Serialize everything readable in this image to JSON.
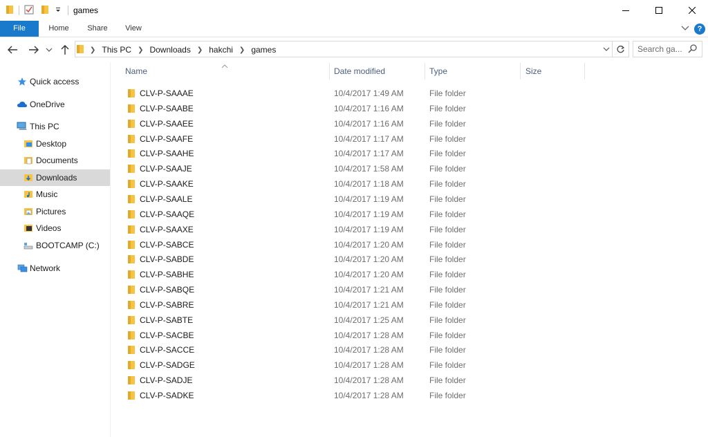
{
  "window": {
    "title": "games"
  },
  "ribbon": {
    "tabs": [
      "File",
      "Home",
      "Share",
      "View"
    ]
  },
  "address": {
    "crumbs": [
      "This PC",
      "Downloads",
      "hakchi",
      "games"
    ],
    "search_placeholder": "Search ga..."
  },
  "sidebar": {
    "items": [
      {
        "label": "Quick access",
        "icon": "star-icon"
      },
      {
        "label": "OneDrive",
        "icon": "onedrive-icon"
      },
      {
        "label": "This PC",
        "icon": "computer-icon"
      },
      {
        "label": "Desktop",
        "icon": "desktop-folder-icon"
      },
      {
        "label": "Documents",
        "icon": "documents-folder-icon"
      },
      {
        "label": "Downloads",
        "icon": "downloads-folder-icon",
        "selected": true
      },
      {
        "label": "Music",
        "icon": "music-folder-icon"
      },
      {
        "label": "Pictures",
        "icon": "pictures-folder-icon"
      },
      {
        "label": "Videos",
        "icon": "videos-folder-icon"
      },
      {
        "label": "BOOTCAMP (C:)",
        "icon": "drive-icon"
      },
      {
        "label": "Network",
        "icon": "network-icon"
      }
    ]
  },
  "columns": {
    "name": "Name",
    "date": "Date modified",
    "type": "Type",
    "size": "Size"
  },
  "files": [
    {
      "name": "CLV-P-SAAAE",
      "date": "10/4/2017 1:49 AM",
      "type": "File folder"
    },
    {
      "name": "CLV-P-SAABE",
      "date": "10/4/2017 1:16 AM",
      "type": "File folder"
    },
    {
      "name": "CLV-P-SAAEE",
      "date": "10/4/2017 1:16 AM",
      "type": "File folder"
    },
    {
      "name": "CLV-P-SAAFE",
      "date": "10/4/2017 1:17 AM",
      "type": "File folder"
    },
    {
      "name": "CLV-P-SAAHE",
      "date": "10/4/2017 1:17 AM",
      "type": "File folder"
    },
    {
      "name": "CLV-P-SAAJE",
      "date": "10/4/2017 1:58 AM",
      "type": "File folder"
    },
    {
      "name": "CLV-P-SAAKE",
      "date": "10/4/2017 1:18 AM",
      "type": "File folder"
    },
    {
      "name": "CLV-P-SAALE",
      "date": "10/4/2017 1:19 AM",
      "type": "File folder"
    },
    {
      "name": "CLV-P-SAAQE",
      "date": "10/4/2017 1:19 AM",
      "type": "File folder"
    },
    {
      "name": "CLV-P-SAAXE",
      "date": "10/4/2017 1:19 AM",
      "type": "File folder"
    },
    {
      "name": "CLV-P-SABCE",
      "date": "10/4/2017 1:20 AM",
      "type": "File folder"
    },
    {
      "name": "CLV-P-SABDE",
      "date": "10/4/2017 1:20 AM",
      "type": "File folder"
    },
    {
      "name": "CLV-P-SABHE",
      "date": "10/4/2017 1:20 AM",
      "type": "File folder"
    },
    {
      "name": "CLV-P-SABQE",
      "date": "10/4/2017 1:21 AM",
      "type": "File folder"
    },
    {
      "name": "CLV-P-SABRE",
      "date": "10/4/2017 1:21 AM",
      "type": "File folder"
    },
    {
      "name": "CLV-P-SABTE",
      "date": "10/4/2017 1:25 AM",
      "type": "File folder"
    },
    {
      "name": "CLV-P-SACBE",
      "date": "10/4/2017 1:28 AM",
      "type": "File folder"
    },
    {
      "name": "CLV-P-SACCE",
      "date": "10/4/2017 1:28 AM",
      "type": "File folder"
    },
    {
      "name": "CLV-P-SADGE",
      "date": "10/4/2017 1:28 AM",
      "type": "File folder"
    },
    {
      "name": "CLV-P-SADJE",
      "date": "10/4/2017 1:28 AM",
      "type": "File folder"
    },
    {
      "name": "CLV-P-SADKE",
      "date": "10/4/2017 1:28 AM",
      "type": "File folder"
    }
  ],
  "colors": {
    "accent": "#1979ca",
    "folder": "#f6c342",
    "selected": "#d9d9d9"
  }
}
